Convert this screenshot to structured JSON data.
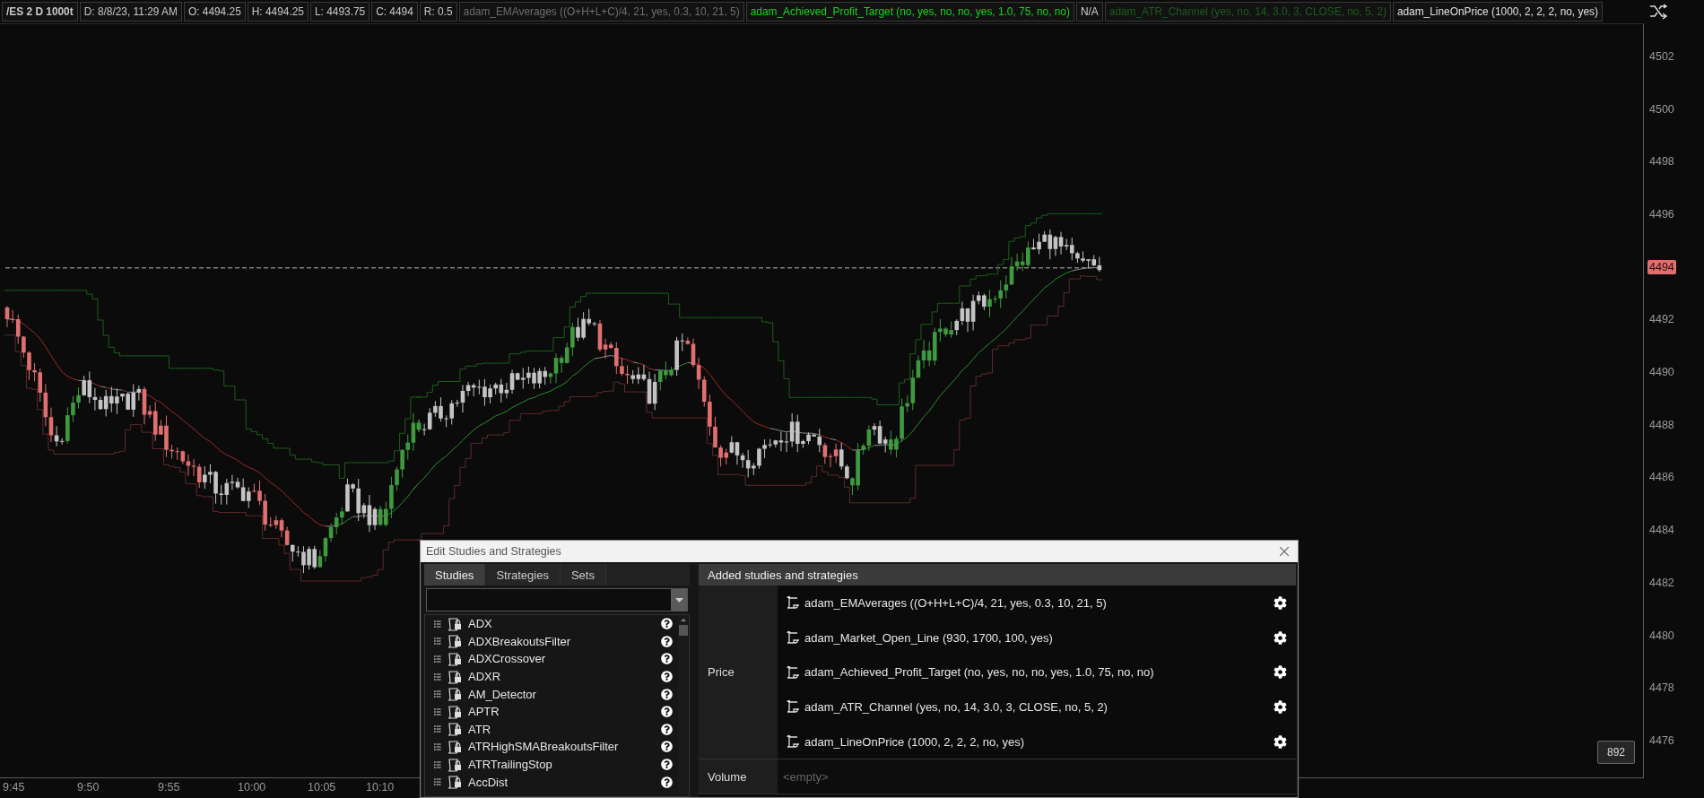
{
  "header": {
    "symbol": "/ES 2 D 1000t",
    "fields": [
      "D: 8/8/23, 11:29 AM",
      "O: 4494.25",
      "H: 4494.25",
      "L: 4493.75",
      "C: 4494",
      "R: 0.5"
    ],
    "studies": [
      {
        "label": "adam_EMAverages ((O+H+L+C)/4, 21, yes, 0.3, 10, 21, 5)",
        "color": "#6e6e6e"
      },
      {
        "label": "adam_Achieved_Profit_Target (no, yes, no, no, yes, 1.0, 75, no, no)",
        "color": "#1ed21e"
      },
      {
        "label": "N/A",
        "color": "#d0d0d0"
      },
      {
        "label": "adam_ATR_Channel (yes, no, 14, 3.0, 3, CLOSE, no, 5, 2)",
        "color": "#1d5c1d"
      },
      {
        "label": "adam_LineOnPrice (1000, 2, 2, 2, no, yes)",
        "color": "#e0e0e0"
      }
    ]
  },
  "price_axis": {
    "ticks": [
      {
        "label": "4502",
        "current": false
      },
      {
        "label": "4500",
        "current": false
      },
      {
        "label": "4498",
        "current": false
      },
      {
        "label": "4496",
        "current": false
      },
      {
        "label": "4494",
        "current": true
      },
      {
        "label": "4492",
        "current": false
      },
      {
        "label": "4490",
        "current": false
      },
      {
        "label": "4488",
        "current": false
      },
      {
        "label": "4486",
        "current": false
      },
      {
        "label": "4484",
        "current": false
      },
      {
        "label": "4482",
        "current": false
      },
      {
        "label": "4480",
        "current": false
      },
      {
        "label": "4478",
        "current": false
      },
      {
        "label": "4476",
        "current": false
      }
    ]
  },
  "time_axis": {
    "ticks": [
      "9:45",
      "9:50",
      "9:55",
      "10:00",
      "10:05",
      "10:10"
    ]
  },
  "bar_count": "892",
  "dialog": {
    "title": "Edit Studies and Strategies",
    "tabs": [
      {
        "label": "Studies",
        "selected": true
      },
      {
        "label": "Strategies",
        "selected": false
      },
      {
        "label": "Sets",
        "selected": false
      }
    ],
    "studies": [
      "ADX",
      "ADXBreakoutsFilter",
      "ADXCrossover",
      "ADXR",
      "AM_Detector",
      "APTR",
      "ATR",
      "ATRHighSMABreakoutsFilter",
      "ATRTrailingStop",
      "AccDist"
    ],
    "added_header": "Added studies and strategies",
    "groups": [
      {
        "name": "Price",
        "items": [
          "adam_EMAverages ((O+H+L+C)/4, 21, yes, 0.3, 10, 21, 5)",
          "adam_Market_Open_Line (930, 1700, 100, yes)",
          "adam_Achieved_Profit_Target (no, yes, no, no, yes, 1.0, 75, no, no)",
          "adam_ATR_Channel (yes, no, 14, 3.0, 3, CLOSE, no, 5, 2)",
          "adam_LineOnPrice (1000, 2, 2, 2, no, yes)"
        ]
      },
      {
        "name": "Volume",
        "empty_text": "<empty>"
      }
    ]
  }
}
